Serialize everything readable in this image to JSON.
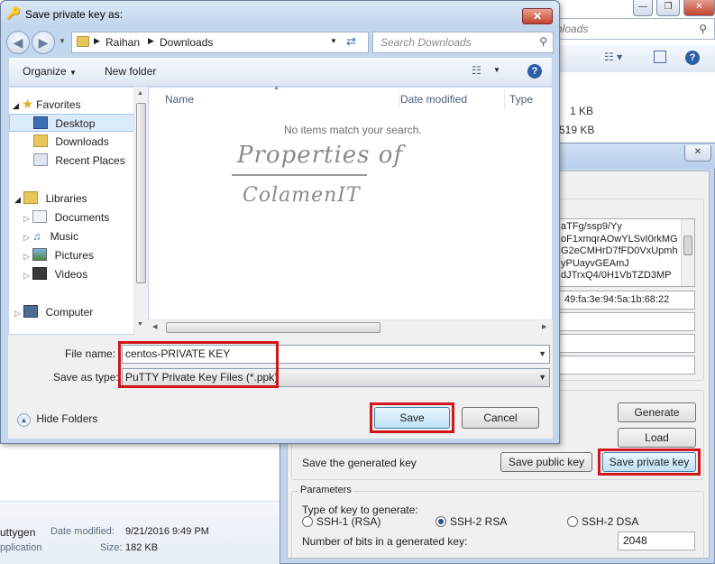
{
  "background_explorer": {
    "address_text": "nloads",
    "file_sizes": [
      "1 KB",
      "519 KB"
    ],
    "details": {
      "name": "uttygen",
      "modified_label": "Date modified:",
      "modified_value": "9/21/2016 9:49 PM",
      "type_value": "pplication",
      "size_label": "Size:",
      "size_value": "182 KB"
    }
  },
  "putty": {
    "key_lines": [
      "aTFg/ssp9/Yy",
      "oF1xmqrAOwYLSvI0rkMG",
      "G2eCMHrD7fFD0VxUpmh",
      "yPUayvGEAmJ",
      "dJTrxQ4/0H1VbTZD3MP"
    ],
    "fingerprint_tail": "49:fa:3e:94:5a:1b:68:22",
    "buttons": {
      "generate": "Generate",
      "load": "Load",
      "save_public": "Save public key",
      "save_private": "Save private key"
    },
    "save_generated_label": "Save the generated key",
    "parameters": {
      "group_label": "Parameters",
      "type_label": "Type of key to generate:",
      "options": [
        "SSH-1 (RSA)",
        "SSH-2 RSA",
        "SSH-2 DSA"
      ],
      "selected": "SSH-2 RSA",
      "bits_label": "Number of bits in a generated key:",
      "bits_value": "2048"
    }
  },
  "dialog": {
    "title": "Save private key as:",
    "breadcrumb": [
      "Raihan",
      "Downloads"
    ],
    "search_placeholder": "Search Downloads",
    "organize_label": "Organize",
    "new_folder_label": "New folder",
    "nav": {
      "favorites": "Favorites",
      "favorites_items": [
        "Desktop",
        "Downloads",
        "Recent Places"
      ],
      "libraries": "Libraries",
      "libraries_items": [
        "Documents",
        "Music",
        "Pictures",
        "Videos"
      ],
      "computer": "Computer"
    },
    "columns": [
      "Name",
      "Date modified",
      "Type"
    ],
    "empty_message": "No items match your search.",
    "watermark": [
      "Properties of",
      "ColamenIT"
    ],
    "file_name_label": "File name:",
    "file_name_value": "centos-PRIVATE KEY",
    "save_type_label": "Save as type:",
    "save_type_value": "PuTTY Private Key Files (*.ppk)",
    "hide_folders_label": "Hide Folders",
    "save_label": "Save",
    "cancel_label": "Cancel"
  },
  "colors": {
    "highlight_red": "#d0161a",
    "title_blue": "#c2d6ee",
    "link_blue": "#1e3f6f"
  }
}
